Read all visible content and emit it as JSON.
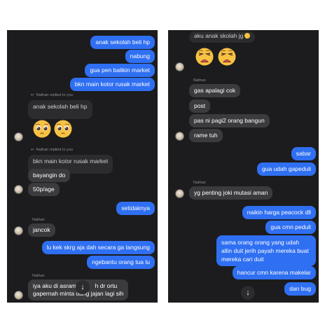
{
  "left_panel": {
    "messages": [
      {
        "text": "anak sekolah beli hp"
      },
      {
        "text": "nabung"
      },
      {
        "text": "gua pen balikin market"
      },
      {
        "text": "bkn main kotor rusak market"
      },
      {
        "reply_note": "Nathan replied to you",
        "quoted": "anak sekolah beli hp"
      },
      {
        "emoji": [
          "pleading-face",
          "pleading-face"
        ]
      },
      {
        "reply_note": "Nathan replied to you",
        "quoted": "bkn main kotor rusak market",
        "text": "bayangin do"
      },
      {
        "text": "50p/age"
      },
      {
        "text": "setidaknya"
      },
      {
        "sender": "Nathan",
        "text": "jancok"
      },
      {
        "text": "lu kek skrg aja dah secara ga langsung"
      },
      {
        "text": "ngebantu orang tua lu"
      },
      {
        "sender": "Nathan",
        "text_line1": "iya aku di asrama",
        "text_line1_tail": "h dr ortu",
        "text_line2": "gapernah minta uang jajan lagi sih"
      }
    ],
    "scroll_button": "↓"
  },
  "right_panel": {
    "messages": [
      {
        "text": "aku anak skolah jg"
      },
      {
        "emoji": [
          "weary-face",
          "weary-face"
        ]
      },
      {
        "sender": "Nathan",
        "text": "gas apalagi cok"
      },
      {
        "text": "post"
      },
      {
        "text": "pas ni pagi2 orang bangun"
      },
      {
        "text": "rame tuh"
      },
      {
        "text": "sabar"
      },
      {
        "text": "gua udah gapeduli"
      },
      {
        "sender": "Nathan",
        "text": "yg penting joki mutasi aman"
      },
      {
        "text": "naikin harga peacock dll"
      },
      {
        "text": "gua cmn peduli"
      },
      {
        "text": "sama orang orang yang udah allin duit jerih payah mereka buat mereka cari duit"
      },
      {
        "text": "hancur cmn karena makelar"
      },
      {
        "text": "dan bug"
      }
    ],
    "scroll_button": "↓"
  },
  "colors": {
    "outgoing_bubble": "#2f6ff2",
    "incoming_bubble": "#3b3b3d",
    "chat_background": "#1c1c1e"
  }
}
